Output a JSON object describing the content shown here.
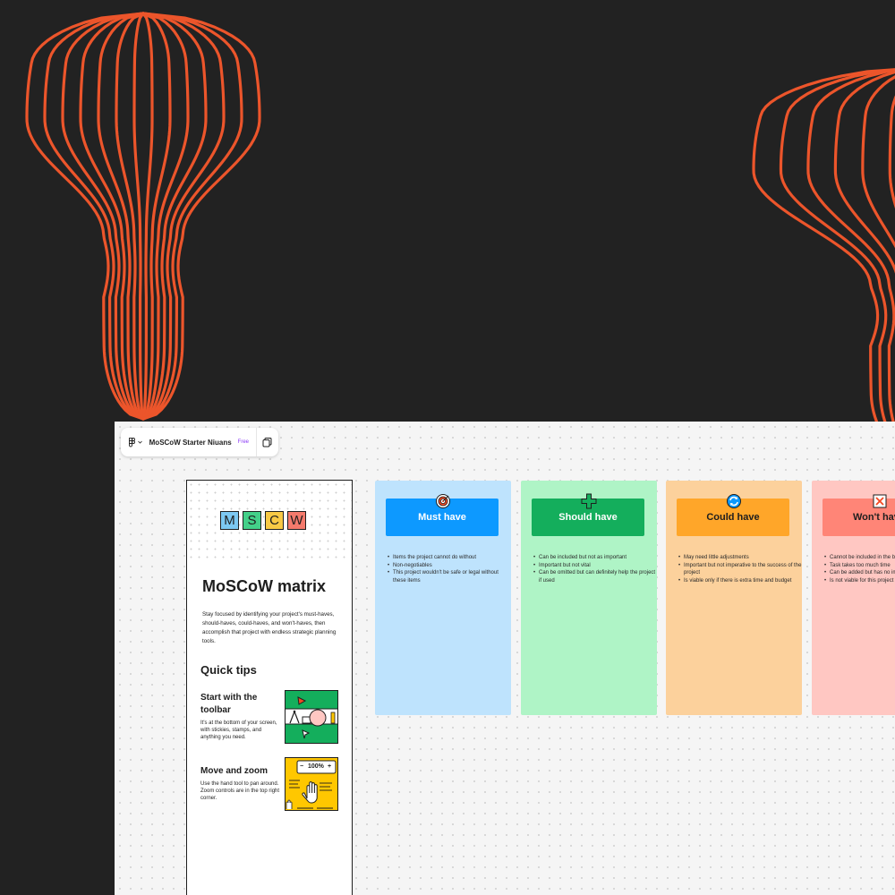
{
  "theme": {
    "background": "#222222",
    "accent_orange": "#ec552b",
    "board_background": "#f5f5f5"
  },
  "topbar": {
    "menu_icon": "figma-logo-icon",
    "dropdown_icon": "chevron-down-icon",
    "file_name": "MoSCoW Starter Niuans",
    "plan_badge": "Free",
    "pages_icon": "pages-icon"
  },
  "panel": {
    "letters": [
      {
        "char": "M",
        "color": "#7cc8f2"
      },
      {
        "char": "S",
        "color": "#43d089"
      },
      {
        "char": "C",
        "color": "#f8c945"
      },
      {
        "char": "W",
        "color": "#f47a6c"
      }
    ],
    "title": "MoSCoW matrix",
    "description": "Stay focused by identifying your project's must-haves, should-haves, could-haves, and won't-haves, then accomplish that project with endless strategic planning tools.",
    "tips_title": "Quick tips",
    "tips": [
      {
        "title": "Start with the toolbar",
        "description": "It's at the bottom of your screen, with stickies, stamps, and anything you need."
      },
      {
        "title": "Move and zoom",
        "description": "Use the hand tool to pan around. Zoom controls are in the top right corner.",
        "zoom_minus": "−",
        "zoom_label": "100%",
        "zoom_plus": "+"
      }
    ]
  },
  "columns": [
    {
      "title": "Must have",
      "icon": "target-icon",
      "card_color": "#bee3fd",
      "header_color": "#0d99ff",
      "header_text_color": "#ffffff",
      "items": [
        "Items the project cannot do without",
        "Non-negotiables",
        "This project wouldn't be safe or legal without these items"
      ]
    },
    {
      "title": "Should have",
      "icon": "plus-icon",
      "card_color": "#aff4c6",
      "header_color": "#14ae5c",
      "header_text_color": "#ffffff",
      "items": [
        "Can be included but not as important",
        "Important but not vital",
        "Can be omitted but can definitely help the project if used"
      ]
    },
    {
      "title": "Could have",
      "icon": "refresh-icon",
      "card_color": "#fcd19c",
      "header_color": "#ffa629",
      "header_text_color": "#1e1e1e",
      "items": [
        "May need little adjustments",
        "Important but not imperative to the success of the project",
        "Is viable only if there is extra time and budget"
      ]
    },
    {
      "title": "Won't have",
      "icon": "x-box-icon",
      "card_color": "#ffc7c2",
      "header_color": "#ff8577",
      "header_text_color": "#1e1e1e",
      "items": [
        "Cannot be included in the budget",
        "Task takes too much time",
        "Can be added but has no impact",
        "Is not viable for this project"
      ]
    }
  ]
}
